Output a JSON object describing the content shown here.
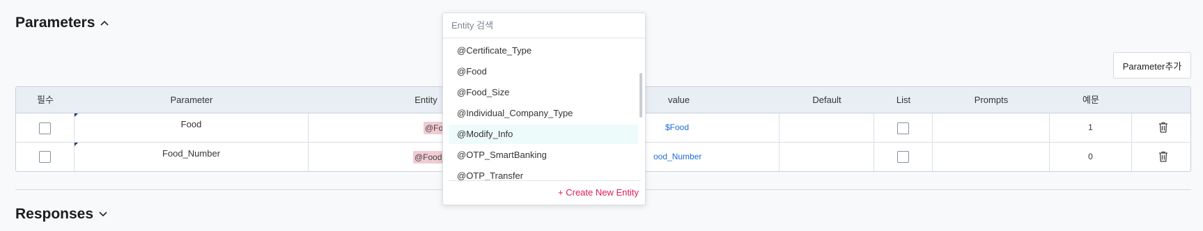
{
  "parameters_section": {
    "title": "Parameters",
    "add_button": "Parameter추가"
  },
  "table": {
    "headers": {
      "required": "필수",
      "parameter": "Parameter",
      "entity": "Entity",
      "value": "value",
      "default": "Default",
      "list": "List",
      "prompts": "Prompts",
      "example": "예문"
    },
    "rows": [
      {
        "parameter": "Food",
        "entity": "@Food",
        "value": "$Food",
        "example": "1"
      },
      {
        "parameter": "Food_Number",
        "entity": "@Food_Size",
        "value": "ood_Number",
        "example": "0"
      }
    ]
  },
  "entity_dropdown": {
    "search_placeholder": "Entity 검색",
    "items": [
      "@Certificate_Type",
      "@Food",
      "@Food_Size",
      "@Individual_Company_Type",
      "@Modify_Info",
      "@OTP_SmartBanking",
      "@OTP_Transfer"
    ],
    "highlighted_item": "@Modify_Info",
    "create_label": "+ Create New Entity"
  },
  "responses_section": {
    "title": "Responses"
  },
  "colors": {
    "accent_link": "#1c6bd4",
    "create_link": "#e0195a",
    "entity_tag_bg": "#f2cbd3",
    "highlight_bg": "#eefbfb"
  }
}
